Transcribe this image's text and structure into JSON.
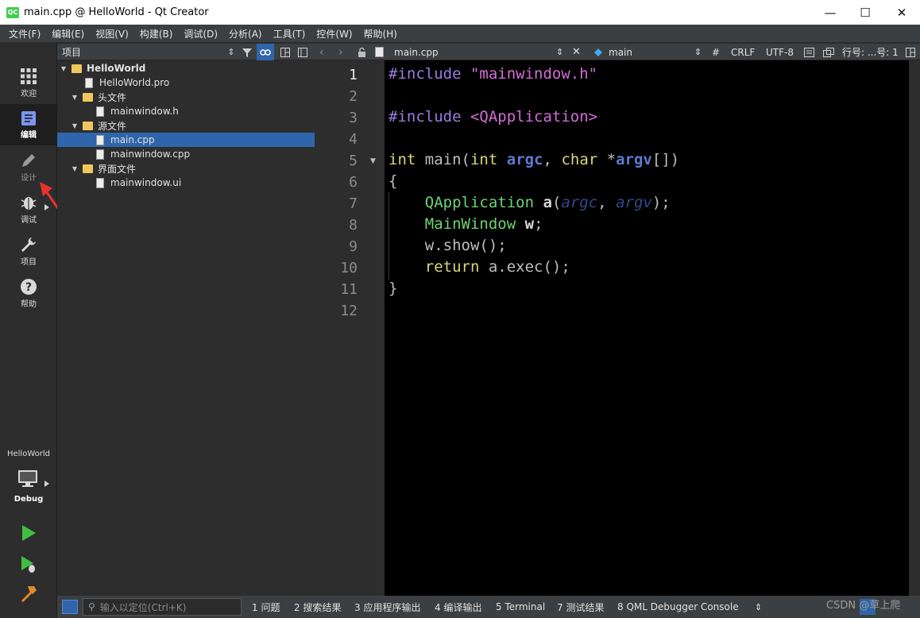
{
  "window": {
    "title": "main.cpp @ HelloWorld - Qt Creator",
    "logo_text": "QC",
    "controls": {
      "minimize": "—",
      "maximize": "☐",
      "close": "✕"
    }
  },
  "menubar": [
    "文件(F)",
    "编辑(E)",
    "视图(V)",
    "构建(B)",
    "调试(D)",
    "分析(A)",
    "工具(T)",
    "控件(W)",
    "帮助(H)"
  ],
  "modes": [
    {
      "label": "欢迎",
      "icon": "grid-icon"
    },
    {
      "label": "编辑",
      "icon": "edit-document-icon"
    },
    {
      "label": "设计",
      "icon": "pencil-icon"
    },
    {
      "label": "调试",
      "icon": "bug-icon"
    },
    {
      "label": "项目",
      "icon": "wrench-icon"
    },
    {
      "label": "帮助",
      "icon": "help-icon"
    }
  ],
  "kit": {
    "project": "HelloWorld",
    "build": "Debug"
  },
  "project_panel": {
    "title": "项目",
    "tree": [
      {
        "label": "HelloWorld",
        "type": "project"
      },
      {
        "label": "HelloWorld.pro",
        "type": "file"
      },
      {
        "label": "头文件",
        "type": "folder"
      },
      {
        "label": "mainwindow.h",
        "type": "file"
      },
      {
        "label": "源文件",
        "type": "folder"
      },
      {
        "label": "main.cpp",
        "type": "file"
      },
      {
        "label": "mainwindow.cpp",
        "type": "file"
      },
      {
        "label": "界面文件",
        "type": "folder"
      },
      {
        "label": "mainwindow.ui",
        "type": "file"
      }
    ]
  },
  "editor_toolbar": {
    "file": "main.cpp",
    "symbol": "main",
    "hash": "#",
    "line_ending": "CRLF",
    "encoding": "UTF-8",
    "position": "行号: ...号: 1"
  },
  "editor": {
    "current_line": 1,
    "line_numbers": [
      "1",
      "2",
      "3",
      "4",
      "5",
      "6",
      "7",
      "8",
      "9",
      "10",
      "11",
      "12"
    ]
  },
  "statusbar": {
    "locator_placeholder": "输入以定位(Ctrl+K)",
    "panes": [
      "1 问题",
      "2 搜索结果",
      "3 应用程序输出",
      "4 编译输出",
      "5 Terminal",
      "7 测试结果",
      "8 QML Debugger Console"
    ],
    "watermark": "CSDN @草上爬"
  }
}
